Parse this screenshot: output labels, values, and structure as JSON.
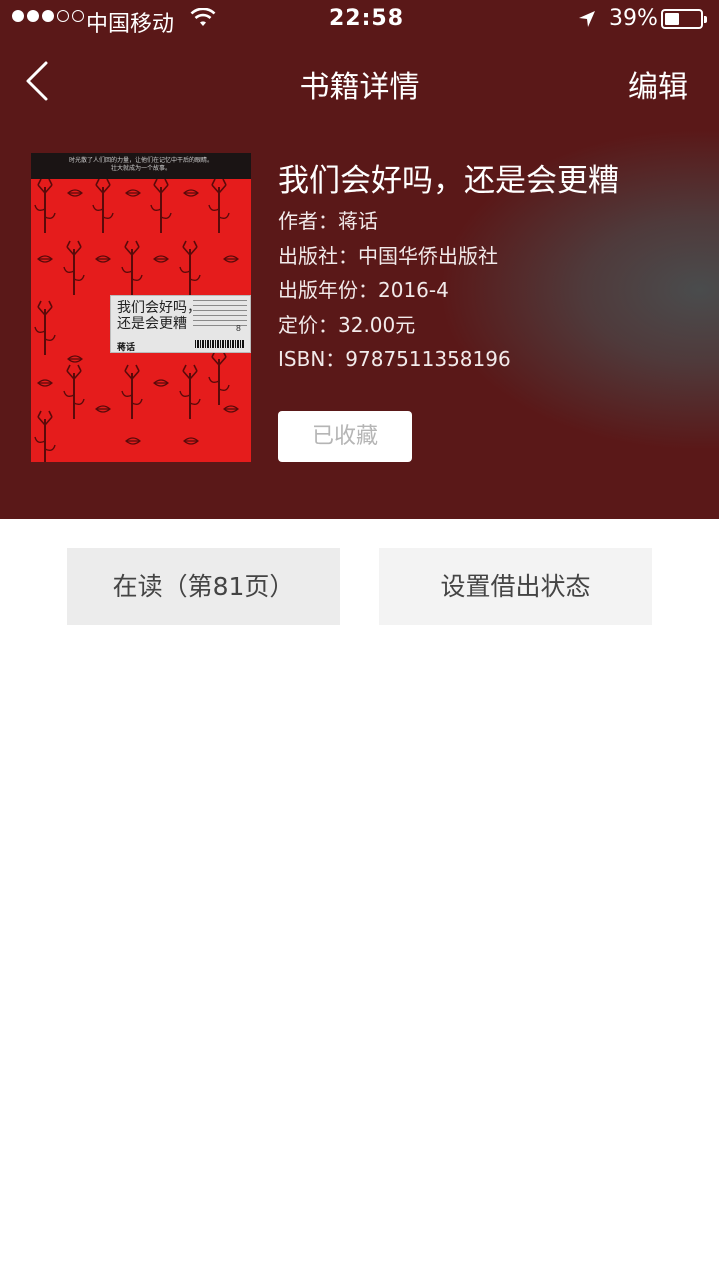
{
  "status_bar": {
    "carrier": "中国移动",
    "time": "22:58",
    "battery_percent": "39%",
    "battery_level": 0.39,
    "signal_bars": 3,
    "signal_total": 5
  },
  "nav": {
    "title": "书籍详情",
    "edit_label": "编辑",
    "back_icon": "chevron-left-icon"
  },
  "book": {
    "title": "我们会好吗，还是会更糟",
    "fields": [
      {
        "key": "作者：",
        "value": "蒋话"
      },
      {
        "key": "出版社：",
        "value": "中国华侨出版社"
      },
      {
        "key": "出版年份：",
        "value": "2016-4"
      },
      {
        "key": "定价：",
        "value": "32.00元"
      },
      {
        "key": "ISBN：",
        "value": "9787511358196"
      }
    ],
    "collect_label": "已收藏",
    "cover": {
      "top_text_1": "时光散了人们回的力量，让他们在记忆中干后的眼睛。",
      "top_text_2": "壮大就成为一个故事。",
      "title_line1": "我们会好吗，",
      "title_line2": "还是会更糟",
      "author": "蒋话",
      "number": "8",
      "color": "#e51c1c"
    }
  },
  "actions": {
    "reading_label": "在读（第81页）",
    "lend_label": "设置借出状态"
  },
  "colors": {
    "header_bg": "#5a1818",
    "header_highlight": "#4a4c4d",
    "button_bg": "#ececec"
  }
}
